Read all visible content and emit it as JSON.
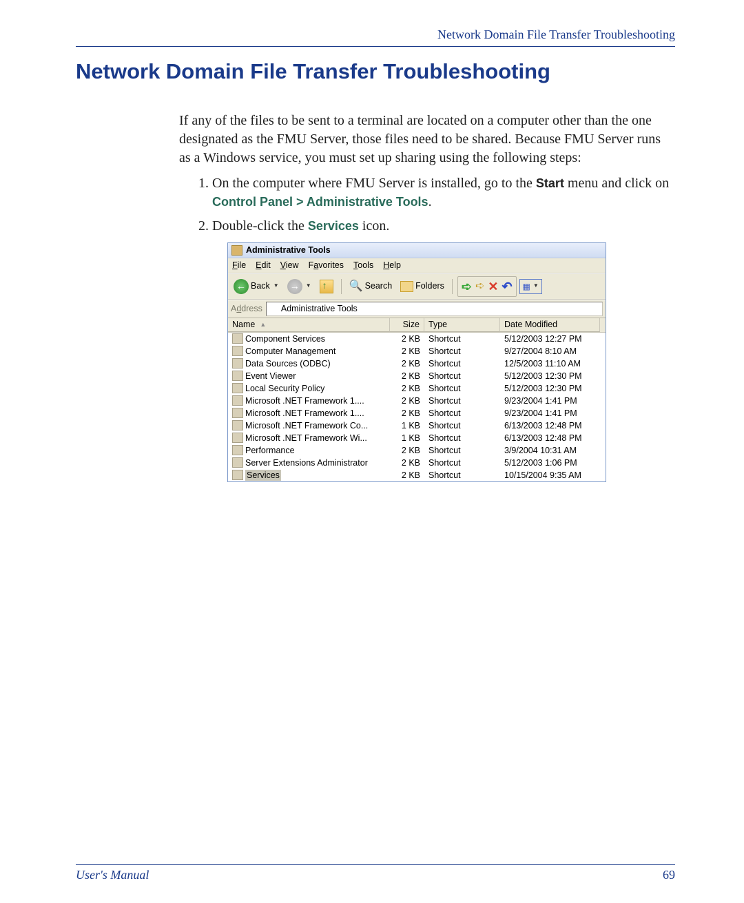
{
  "header": {
    "running_title": "Network Domain File Transfer Troubleshooting"
  },
  "title": "Network Domain File Transfer Troubleshooting",
  "intro": "If any of the files to be sent to a terminal are located on a computer other than the one designated as the FMU Server, those files need to be shared. Because FMU Server runs as a Windows service, you must set up sharing using the following steps:",
  "step1": {
    "prefix": "On the computer where FMU Server is installed, go to the ",
    "start": "Start",
    "mid": " menu and click on ",
    "cp": "Control Panel",
    "gt": " > ",
    "at": "Administrative Tools",
    "end": "."
  },
  "step2": {
    "prefix": "Double-click the ",
    "svc": "Services",
    "suffix": " icon."
  },
  "window": {
    "title": "Administrative Tools",
    "menus": {
      "file": {
        "u": "F",
        "rest": "ile"
      },
      "edit": {
        "u": "E",
        "rest": "dit"
      },
      "view": {
        "u": "V",
        "rest": "iew"
      },
      "favorites": {
        "u": "a",
        "prefix": "F",
        "rest": "vorites"
      },
      "tools": {
        "u": "T",
        "rest": "ools"
      },
      "help": {
        "u": "H",
        "rest": "elp"
      }
    },
    "toolbar": {
      "back": "Back",
      "search": "Search",
      "folders": "Folders"
    },
    "address": {
      "label_u": "d",
      "label_prefix": "A",
      "label_rest": "dress",
      "value": "Administrative Tools"
    },
    "columns": {
      "name": "Name",
      "size": "Size",
      "type": "Type",
      "date": "Date Modified"
    },
    "rows": [
      {
        "name": "Component Services",
        "size": "2 KB",
        "type": "Shortcut",
        "date": "5/12/2003 12:27 PM",
        "sel": false
      },
      {
        "name": "Computer Management",
        "size": "2 KB",
        "type": "Shortcut",
        "date": "9/27/2004 8:10 AM",
        "sel": false
      },
      {
        "name": "Data Sources (ODBC)",
        "size": "2 KB",
        "type": "Shortcut",
        "date": "12/5/2003 11:10 AM",
        "sel": false
      },
      {
        "name": "Event Viewer",
        "size": "2 KB",
        "type": "Shortcut",
        "date": "5/12/2003 12:30 PM",
        "sel": false
      },
      {
        "name": "Local Security Policy",
        "size": "2 KB",
        "type": "Shortcut",
        "date": "5/12/2003 12:30 PM",
        "sel": false
      },
      {
        "name": "Microsoft .NET Framework 1....",
        "size": "2 KB",
        "type": "Shortcut",
        "date": "9/23/2004 1:41 PM",
        "sel": false
      },
      {
        "name": "Microsoft .NET Framework 1....",
        "size": "2 KB",
        "type": "Shortcut",
        "date": "9/23/2004 1:41 PM",
        "sel": false
      },
      {
        "name": "Microsoft .NET Framework Co...",
        "size": "1 KB",
        "type": "Shortcut",
        "date": "6/13/2003 12:48 PM",
        "sel": false
      },
      {
        "name": "Microsoft .NET Framework Wi...",
        "size": "1 KB",
        "type": "Shortcut",
        "date": "6/13/2003 12:48 PM",
        "sel": false
      },
      {
        "name": "Performance",
        "size": "2 KB",
        "type": "Shortcut",
        "date": "3/9/2004 10:31 AM",
        "sel": false
      },
      {
        "name": "Server Extensions Administrator",
        "size": "2 KB",
        "type": "Shortcut",
        "date": "5/12/2003 1:06 PM",
        "sel": false
      },
      {
        "name": "Services",
        "size": "2 KB",
        "type": "Shortcut",
        "date": "10/15/2004 9:35 AM",
        "sel": true
      }
    ]
  },
  "footer": {
    "left": "User's Manual",
    "right": "69"
  }
}
